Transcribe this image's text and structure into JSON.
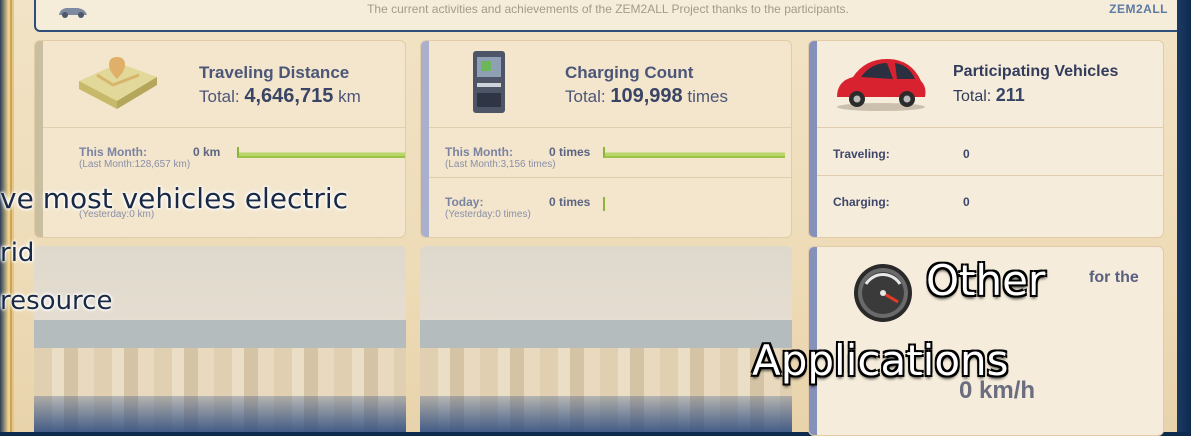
{
  "header": {
    "subtitle": "The current activities and achievements of the ZEM2ALL Project thanks to the participants.",
    "brand": "ZEM2ALL"
  },
  "panels": {
    "distance": {
      "title": "Traveling Distance",
      "total_prefix": "Total: ",
      "total_value": "4,646,715",
      "total_unit": " km",
      "this_month_label": "This Month:",
      "this_month_value": "0 km",
      "last_month": "(Last Month:128,657 km)",
      "yesterday": "(Yesterday:0 km)"
    },
    "charging": {
      "title": "Charging Count",
      "total_prefix": "Total: ",
      "total_value": "109,998",
      "total_unit": " times",
      "this_month_label": "This Month:",
      "this_month_value": "0 times",
      "last_month": "(Last Month:3,156 times)",
      "today_label": "Today:",
      "today_value": "0 times",
      "yesterday": "(Yesterday:0 times)"
    },
    "vehicles": {
      "title": "Participating Vehicles",
      "total_prefix": "Total: ",
      "total_value": "211",
      "traveling_label": "Traveling:",
      "traveling_value": "0",
      "charging_label": "Charging:",
      "charging_value": "0"
    },
    "speed": {
      "partial_label": "for the",
      "value": "0 km/h"
    }
  },
  "overlay": {
    "line1": "ve most vehicles electric",
    "line2": "rid",
    "line3": "resource",
    "big_line1": "Other",
    "big_line2": "Applications"
  },
  "colors": {
    "accent": "#4c5678",
    "bar": "#9cc24a",
    "frame": "#2f4f7b"
  }
}
